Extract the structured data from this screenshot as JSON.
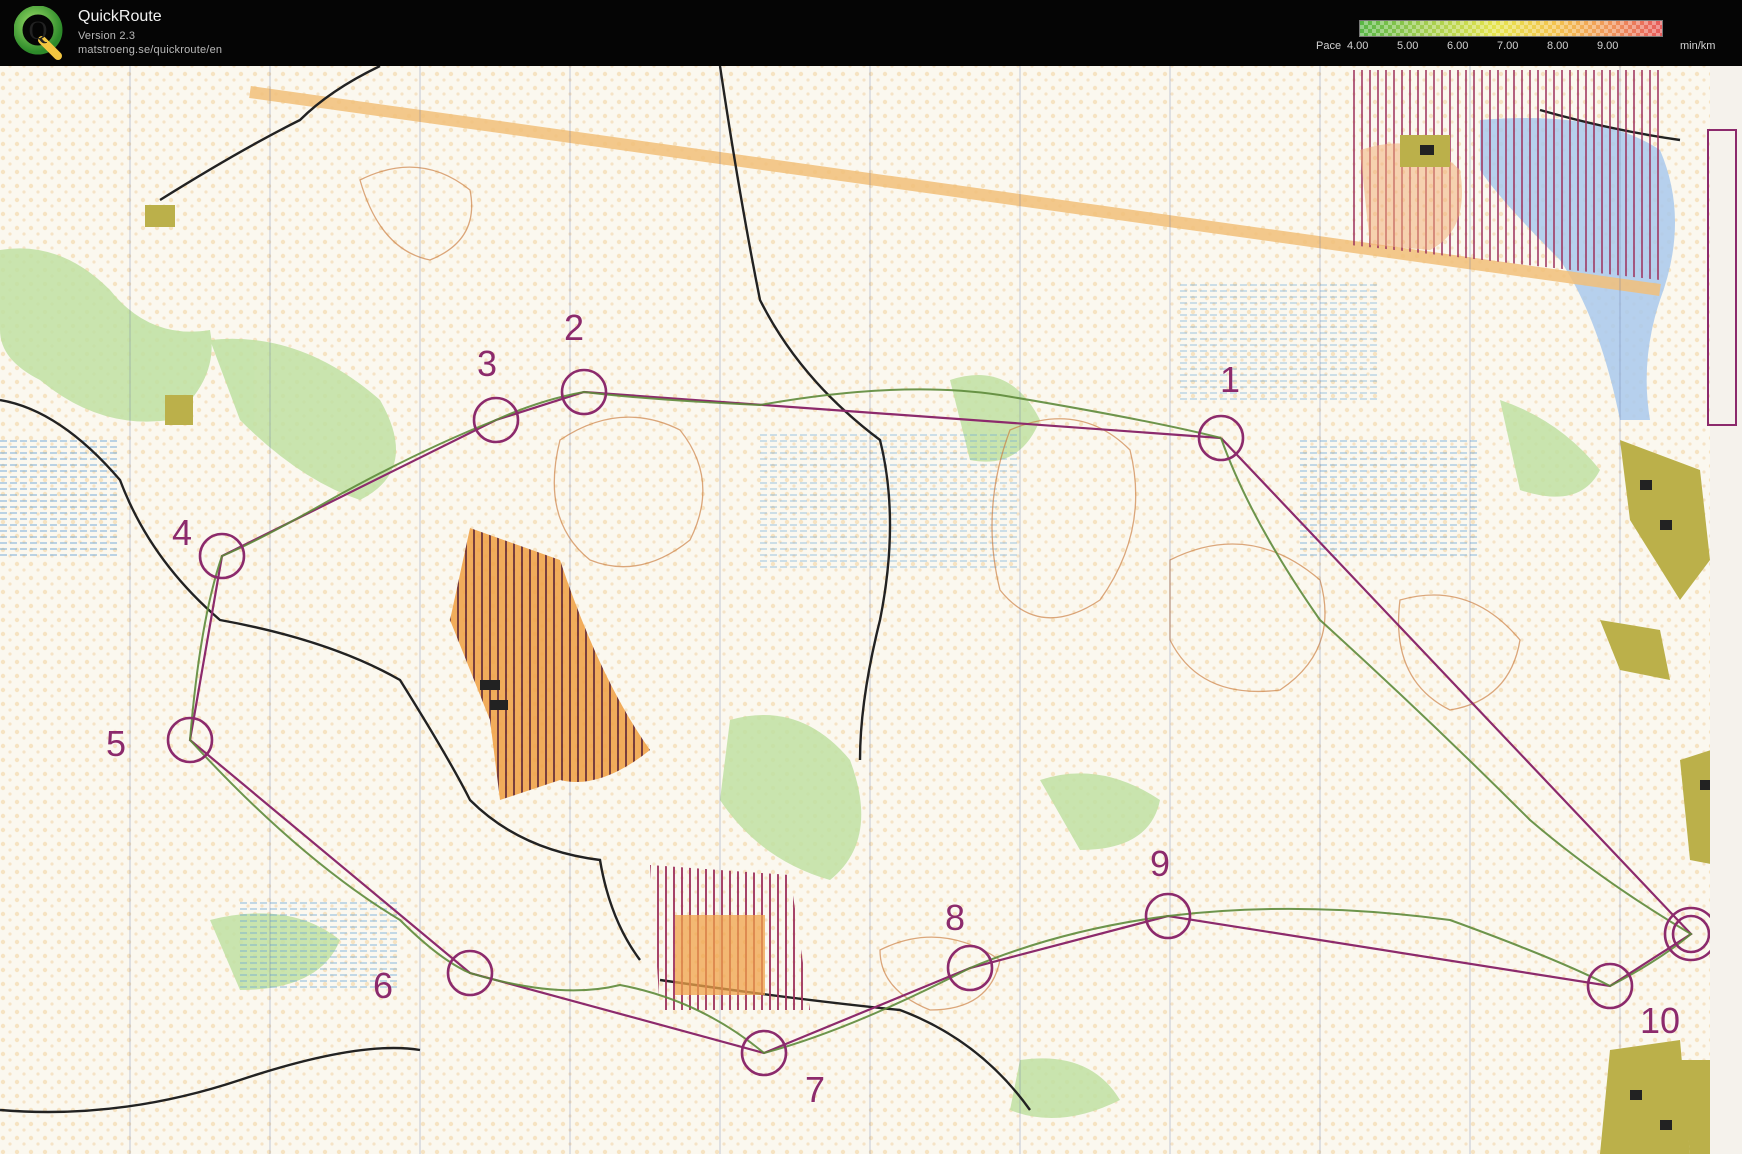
{
  "app": {
    "title": "QuickRoute",
    "version": "Version 2.3",
    "url": "matstroeng.se/quickroute/en",
    "logo_letter": "Q"
  },
  "pace_legend": {
    "label": "Pace",
    "ticks": [
      "4.00",
      "5.00",
      "6.00",
      "7.00",
      "8.00",
      "9.00"
    ],
    "unit": "min/km",
    "colors": [
      "#58b646",
      "#9ccb4f",
      "#e6e44d",
      "#f3c24e",
      "#f0985a",
      "#e65b5b"
    ]
  },
  "map": {
    "course_color": "#8c2a6c",
    "route_color": "#5d8a3a",
    "controls": [
      {
        "label": "1"
      },
      {
        "label": "2"
      },
      {
        "label": "3"
      },
      {
        "label": "4"
      },
      {
        "label": "5"
      },
      {
        "label": "6"
      },
      {
        "label": "7"
      },
      {
        "label": "8"
      },
      {
        "label": "9"
      },
      {
        "label": "10"
      }
    ]
  }
}
